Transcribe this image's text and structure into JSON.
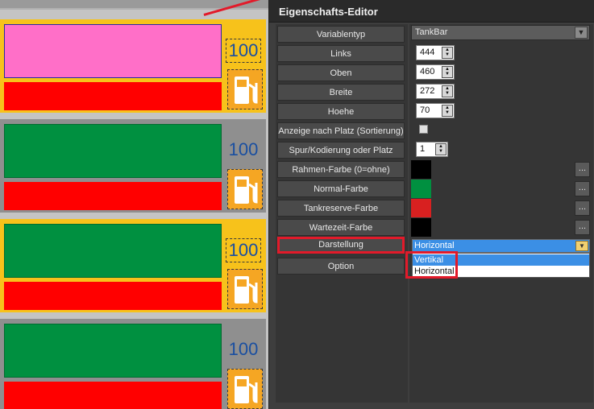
{
  "editor": {
    "title": "Eigenschafts-Editor",
    "rows": [
      {
        "label": "Variablentyp"
      },
      {
        "label": "Links"
      },
      {
        "label": "Oben"
      },
      {
        "label": "Breite"
      },
      {
        "label": "Hoehe"
      },
      {
        "label": "Anzeige nach Platz (Sortierung)"
      },
      {
        "label": "Spur/Kodierung oder Platz"
      },
      {
        "label": "Rahmen-Farbe (0=ohne)"
      },
      {
        "label": "Normal-Farbe"
      },
      {
        "label": "Tankreserve-Farbe"
      },
      {
        "label": "Wartezeit-Farbe"
      },
      {
        "label": "Darstellung"
      },
      {
        "label": "Option"
      }
    ],
    "variablentyp": "TankBar",
    "links": "444",
    "oben": "460",
    "breite": "272",
    "hoehe": "70",
    "spur": "1",
    "ellipsis": "...",
    "colors": {
      "rahmen": "#000000",
      "normal": "#009040",
      "tankreserve": "#d82020",
      "wartezeit": "#000000"
    },
    "darstellung": {
      "selected": "Horizontal",
      "options": [
        "Vertikal",
        "Horizontal"
      ]
    }
  },
  "canvas": {
    "rows": [
      {
        "value": "100",
        "main_color": "#ff6fc8",
        "bg_color": "#f7c21b"
      },
      {
        "value": "100",
        "main_color": "#009040",
        "bg_color": "#8f8f8f"
      },
      {
        "value": "100",
        "main_color": "#009040",
        "bg_color": "#f7c21b"
      },
      {
        "value": "100",
        "main_color": "#009040",
        "bg_color": "#8f8f8f"
      }
    ]
  }
}
